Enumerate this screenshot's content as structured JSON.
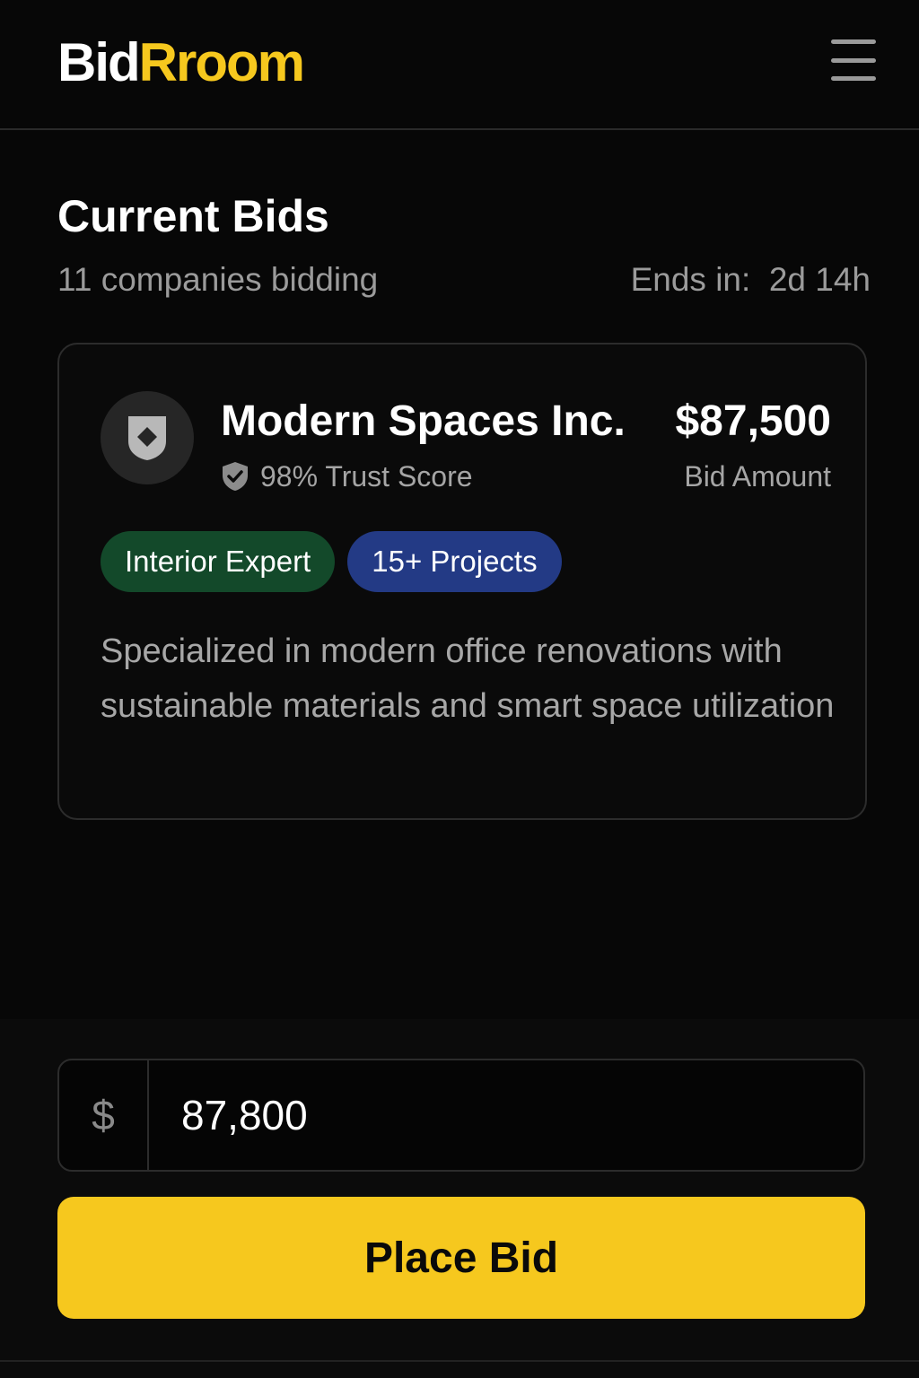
{
  "app": {
    "logo_part1": "Bid",
    "logo_part2": "Rroom",
    "brand_color": "#f6c81e",
    "menu_icon": "hamburger-menu-icon"
  },
  "section": {
    "title": "Current Bids",
    "companies_count": "11 companies bidding",
    "ends_in": "Ends in:  2d 14h"
  },
  "bid_card": {
    "company_name": "Modern Spaces Inc.",
    "avatar_icon": "shield-logo-icon",
    "trust_icon": "shield-check-icon",
    "trust_score": "98% Trust Score",
    "bid_amount": "$87,500",
    "bid_amount_label": "Bid Amount",
    "tags": [
      {
        "label": "Interior Expert",
        "color": "#13492a"
      },
      {
        "label": "15+ Projects",
        "color": "#233a85"
      }
    ],
    "description": "Specialized in modern office renovations with sustainable materials and smart space utilization"
  },
  "bid_form": {
    "currency_symbol": "$",
    "amount_value": "87,800",
    "submit_label": "Place Bid"
  }
}
